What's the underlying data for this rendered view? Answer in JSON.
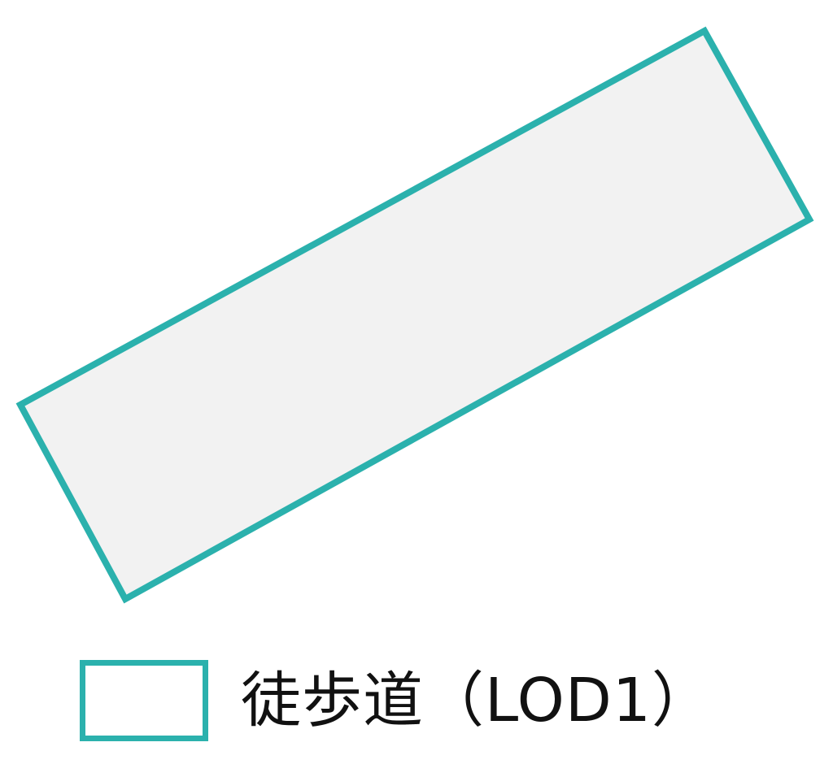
{
  "legend": {
    "label": "徒歩道（LOD1）"
  },
  "colors": {
    "outline": "#2bb1ad",
    "fill": "#f2f2f2",
    "text": "#111111"
  },
  "feature": {
    "name": "walkway-polygon",
    "shape": "rotated-rectangle"
  }
}
